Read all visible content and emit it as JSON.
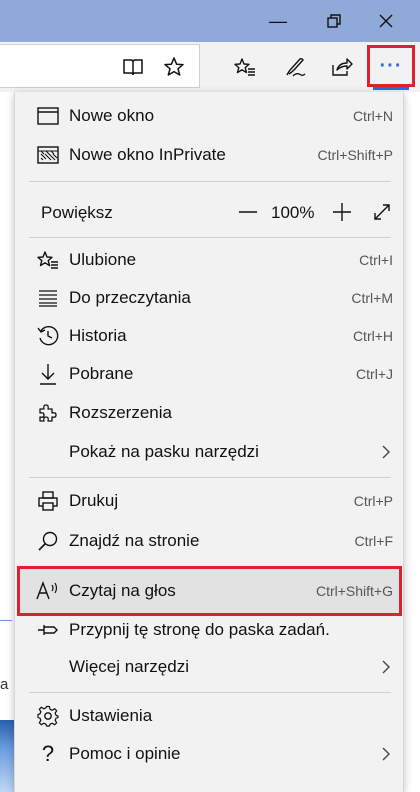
{
  "window": {
    "minimize_glyph": "—",
    "maximize_glyph": "❐",
    "close_glyph": "✕"
  },
  "toolbar": {
    "more_glyph": "···",
    "accent_color": "#2b6fd6",
    "highlight_color": "#e0202a"
  },
  "menu": {
    "new_window": {
      "label": "Nowe okno",
      "shortcut": "Ctrl+N"
    },
    "new_inprivate": {
      "label": "Nowe okno InPrivate",
      "shortcut": "Ctrl+Shift+P"
    },
    "zoom": {
      "label": "Powiększ",
      "value": "100%",
      "minus": "—",
      "plus": "+"
    },
    "favorites": {
      "label": "Ulubione",
      "shortcut": "Ctrl+I"
    },
    "reading_list": {
      "label": "Do przeczytania",
      "shortcut": "Ctrl+M"
    },
    "history": {
      "label": "Historia",
      "shortcut": "Ctrl+H"
    },
    "downloads": {
      "label": "Pobrane",
      "shortcut": "Ctrl+J"
    },
    "extensions": {
      "label": "Rozszerzenia"
    },
    "show_in_toolbar": {
      "label": "Pokaż na pasku narzędzi",
      "chevron": "›"
    },
    "print": {
      "label": "Drukuj",
      "shortcut": "Ctrl+P"
    },
    "find": {
      "label": "Znajdź na stronie",
      "shortcut": "Ctrl+F"
    },
    "read_aloud": {
      "label": "Czytaj na głos",
      "shortcut": "Ctrl+Shift+G",
      "icon_text": "A⁾⁾"
    },
    "pin": {
      "label": "Przypnij tę stronę do paska zadań."
    },
    "more_tools": {
      "label": "Więcej narzędzi",
      "chevron": "›"
    },
    "settings": {
      "label": "Ustawienia"
    },
    "help": {
      "label": "Pomoc i opinie",
      "chevron": "›",
      "icon_text": "?"
    }
  },
  "page": {
    "side_letter": "a"
  }
}
